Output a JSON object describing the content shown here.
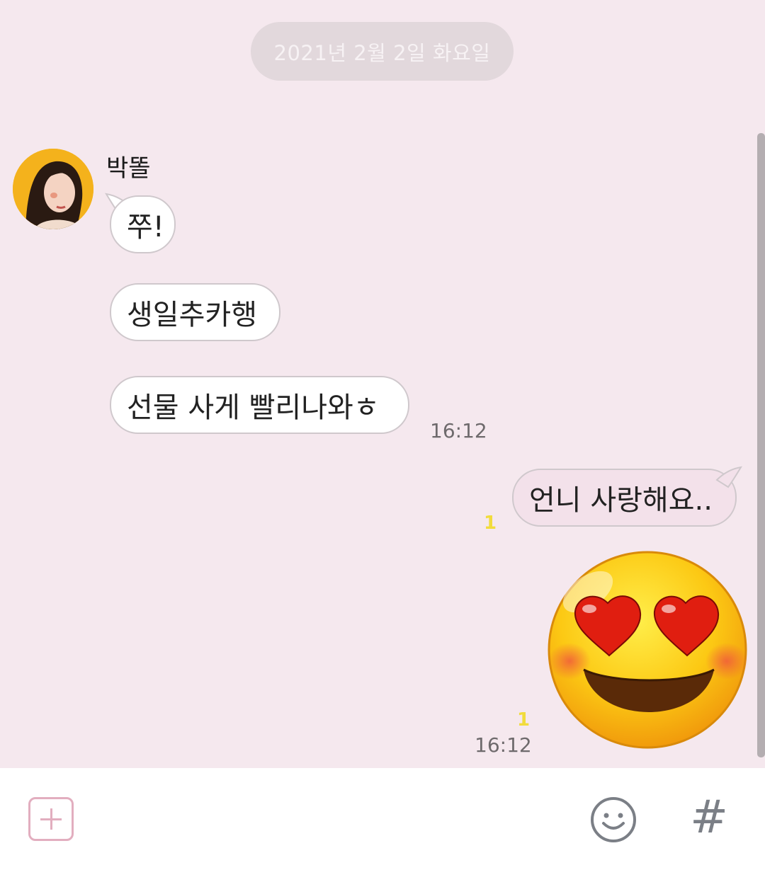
{
  "date_divider": "2021년 2월 2일 화요일",
  "sender": {
    "name": "박똘"
  },
  "incoming_messages": [
    {
      "text": "쭈!"
    },
    {
      "text": "생일추카행"
    },
    {
      "text": "선물 사게 빨리나와ㅎ"
    }
  ],
  "incoming_time": "16:12",
  "outgoing_message": {
    "text": "언니 사랑해요..",
    "unread": "1"
  },
  "emoticon_message": {
    "unread": "1",
    "time": "16:12",
    "icon": "heart-eyes-emoji"
  },
  "input_bar": {
    "plus_icon": "plus-square-icon",
    "emoji_icon": "smiley-icon",
    "hash_label": "#"
  },
  "colors": {
    "background": "#f5e8ee",
    "outgoing_bubble": "#f3e1ea",
    "incoming_bubble": "#ffffff",
    "unread_count": "#f1dc3c",
    "accent_pink": "#e2aebf"
  }
}
